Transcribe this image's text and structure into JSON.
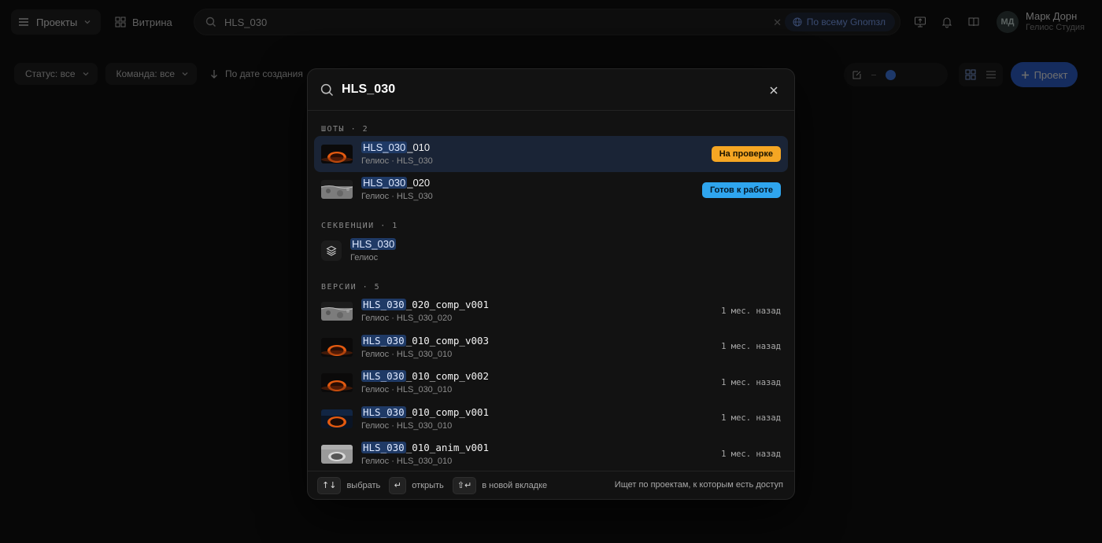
{
  "topbar": {
    "projects_label": "Проекты",
    "showcase_label": "Витрина",
    "search_value": "HLS_030",
    "search_scope": "По всему Gnomзл",
    "user_initials": "МД",
    "user_name": "Марк Дорн",
    "user_org": "Гелиос Студия"
  },
  "toolbar": {
    "filter_status": "Статус: все",
    "filter_team": "Команда: все",
    "sort": "По дате создания",
    "new_project": "Проект"
  },
  "search_modal": {
    "query": "HLS_030",
    "sections": {
      "shots": {
        "title": "ШОТЫ · 2"
      },
      "sequences": {
        "title": "СЕКВЕНЦИИ · 1"
      },
      "versions": {
        "title": "ВЕРСИИ · 5"
      }
    },
    "shots": [
      {
        "match": "HLS_030",
        "rest": "_010",
        "path": "Гелиос · HLS_030",
        "status": "На проверке",
        "thumb": "eclipse"
      },
      {
        "match": "HLS_030",
        "rest": "_020",
        "path": "Гелиос · HLS_030",
        "status": "Готов к работе",
        "thumb": "moon"
      }
    ],
    "sequences": [
      {
        "match": "HLS_030",
        "path": "Гелиос",
        "icon": "layers-icon"
      }
    ],
    "versions": [
      {
        "match": "HLS_030",
        "rest": "_020_comp_v001",
        "path": "Гелиос · HLS_030_020",
        "time": "1 мес. назад",
        "thumb": "moon"
      },
      {
        "match": "HLS_030",
        "rest": "_010_comp_v003",
        "path": "Гелиос · HLS_030_010",
        "time": "1 мес. назад",
        "thumb": "eclipse"
      },
      {
        "match": "HLS_030",
        "rest": "_010_comp_v002",
        "path": "Гелиос · HLS_030_010",
        "time": "1 мес. назад",
        "thumb": "eclipse"
      },
      {
        "match": "HLS_030",
        "rest": "_010_comp_v001",
        "path": "Гелиос · HLS_030_010",
        "time": "1 мес. назад",
        "thumb": "eclipse-blue"
      },
      {
        "match": "HLS_030",
        "rest": "_010_anim_v001",
        "path": "Гелиос · HLS_030_010",
        "time": "1 мес. назад",
        "thumb": "grey"
      }
    ],
    "footer": {
      "key_select": "↑↓",
      "hint_select": "выбрать",
      "key_open": "↵",
      "hint_open": "открыть",
      "key_newtab": "⇧↵",
      "hint_newtab": "в новой вкладке",
      "note": "Ищет по проектам, к которым есть доступ"
    }
  },
  "colors": {
    "accent": "#2960d6",
    "highlight": "#1f3a66",
    "status_review": "#f5a623",
    "status_ready": "#2fa5ee"
  }
}
